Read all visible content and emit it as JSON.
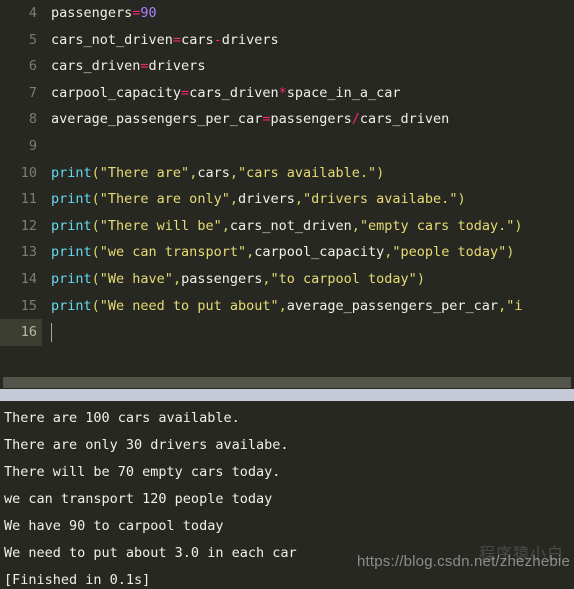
{
  "theme": {
    "editor_background": "#272822",
    "console_background": "#272822",
    "gutter_text": "#7c7f6e",
    "active_line_gutter_background": "#3d3e32",
    "divider": "#c6cad6",
    "scrollbar_thumb": "#53554a",
    "token_plain": "#f2f0e6",
    "token_operator": "#f92672",
    "token_number": "#ae81ff",
    "token_function": "#66d9ef",
    "token_punctuation": "#d7d86a",
    "token_string": "#e6db74",
    "cursor": "#a6a892"
  },
  "editor": {
    "active_line": 16,
    "first_visible_line": 4,
    "last_visible_line": 16,
    "lines": [
      {
        "number": "4",
        "tokens": [
          {
            "t": "passengers",
            "c": "plain"
          },
          {
            "t": "=",
            "c": "op"
          },
          {
            "t": "90",
            "c": "num"
          }
        ]
      },
      {
        "number": "5",
        "tokens": [
          {
            "t": "cars_not_driven",
            "c": "plain"
          },
          {
            "t": "=",
            "c": "op"
          },
          {
            "t": "cars",
            "c": "plain"
          },
          {
            "t": "-",
            "c": "op"
          },
          {
            "t": "drivers",
            "c": "plain"
          }
        ]
      },
      {
        "number": "6",
        "tokens": [
          {
            "t": "cars_driven",
            "c": "plain"
          },
          {
            "t": "=",
            "c": "op"
          },
          {
            "t": "drivers",
            "c": "plain"
          }
        ]
      },
      {
        "number": "7",
        "tokens": [
          {
            "t": "carpool_capacity",
            "c": "plain"
          },
          {
            "t": "=",
            "c": "op"
          },
          {
            "t": "cars_driven",
            "c": "plain"
          },
          {
            "t": "*",
            "c": "op"
          },
          {
            "t": "space_in_a_car",
            "c": "plain"
          }
        ]
      },
      {
        "number": "8",
        "tokens": [
          {
            "t": "average_passengers_per_car",
            "c": "plain"
          },
          {
            "t": "=",
            "c": "op"
          },
          {
            "t": "passengers",
            "c": "plain"
          },
          {
            "t": "/",
            "c": "op"
          },
          {
            "t": "cars_driven",
            "c": "plain"
          }
        ]
      },
      {
        "number": "9",
        "tokens": []
      },
      {
        "number": "10",
        "tokens": [
          {
            "t": "print",
            "c": "fn"
          },
          {
            "t": "(",
            "c": "punc"
          },
          {
            "t": "\"There are\"",
            "c": "str"
          },
          {
            "t": ",",
            "c": "punc"
          },
          {
            "t": "cars",
            "c": "plain"
          },
          {
            "t": ",",
            "c": "punc"
          },
          {
            "t": "\"cars available.\"",
            "c": "str"
          },
          {
            "t": ")",
            "c": "punc"
          }
        ]
      },
      {
        "number": "11",
        "tokens": [
          {
            "t": "print",
            "c": "fn"
          },
          {
            "t": "(",
            "c": "punc"
          },
          {
            "t": "\"There are only\"",
            "c": "str"
          },
          {
            "t": ",",
            "c": "punc"
          },
          {
            "t": "drivers",
            "c": "plain"
          },
          {
            "t": ",",
            "c": "punc"
          },
          {
            "t": "\"drivers availabe.\"",
            "c": "str"
          },
          {
            "t": ")",
            "c": "punc"
          }
        ]
      },
      {
        "number": "12",
        "tokens": [
          {
            "t": "print",
            "c": "fn"
          },
          {
            "t": "(",
            "c": "punc"
          },
          {
            "t": "\"There will be\"",
            "c": "str"
          },
          {
            "t": ",",
            "c": "punc"
          },
          {
            "t": "cars_not_driven",
            "c": "plain"
          },
          {
            "t": ",",
            "c": "punc"
          },
          {
            "t": "\"empty cars today.\"",
            "c": "str"
          },
          {
            "t": ")",
            "c": "punc"
          }
        ]
      },
      {
        "number": "13",
        "tokens": [
          {
            "t": "print",
            "c": "fn"
          },
          {
            "t": "(",
            "c": "punc"
          },
          {
            "t": "\"we can transport\"",
            "c": "str"
          },
          {
            "t": ",",
            "c": "punc"
          },
          {
            "t": "carpool_capacity",
            "c": "plain"
          },
          {
            "t": ",",
            "c": "punc"
          },
          {
            "t": "\"people today\"",
            "c": "str"
          },
          {
            "t": ")",
            "c": "punc"
          }
        ]
      },
      {
        "number": "14",
        "tokens": [
          {
            "t": "print",
            "c": "fn"
          },
          {
            "t": "(",
            "c": "punc"
          },
          {
            "t": "\"We have\"",
            "c": "str"
          },
          {
            "t": ",",
            "c": "punc"
          },
          {
            "t": "passengers",
            "c": "plain"
          },
          {
            "t": ",",
            "c": "punc"
          },
          {
            "t": "\"to carpool today\"",
            "c": "str"
          },
          {
            "t": ")",
            "c": "punc"
          }
        ]
      },
      {
        "number": "15",
        "tokens": [
          {
            "t": "print",
            "c": "fn"
          },
          {
            "t": "(",
            "c": "punc"
          },
          {
            "t": "\"We need to put about\"",
            "c": "str"
          },
          {
            "t": ",",
            "c": "punc"
          },
          {
            "t": "average_passengers_per_car",
            "c": "plain"
          },
          {
            "t": ",",
            "c": "punc"
          },
          {
            "t": "\"i",
            "c": "str"
          }
        ]
      },
      {
        "number": "16",
        "tokens": []
      }
    ]
  },
  "console": {
    "lines": [
      "There are 100 cars available.",
      "There are only 30 drivers availabe.",
      "There will be 70 empty cars today.",
      "we can transport 120 people today",
      "We have 90 to carpool today",
      "We need to put about 3.0 in each car",
      "[Finished in 0.1s]"
    ]
  },
  "watermark": {
    "url": "https://blog.csdn.net/zhezhebie",
    "overlay": "程序猿小白"
  }
}
